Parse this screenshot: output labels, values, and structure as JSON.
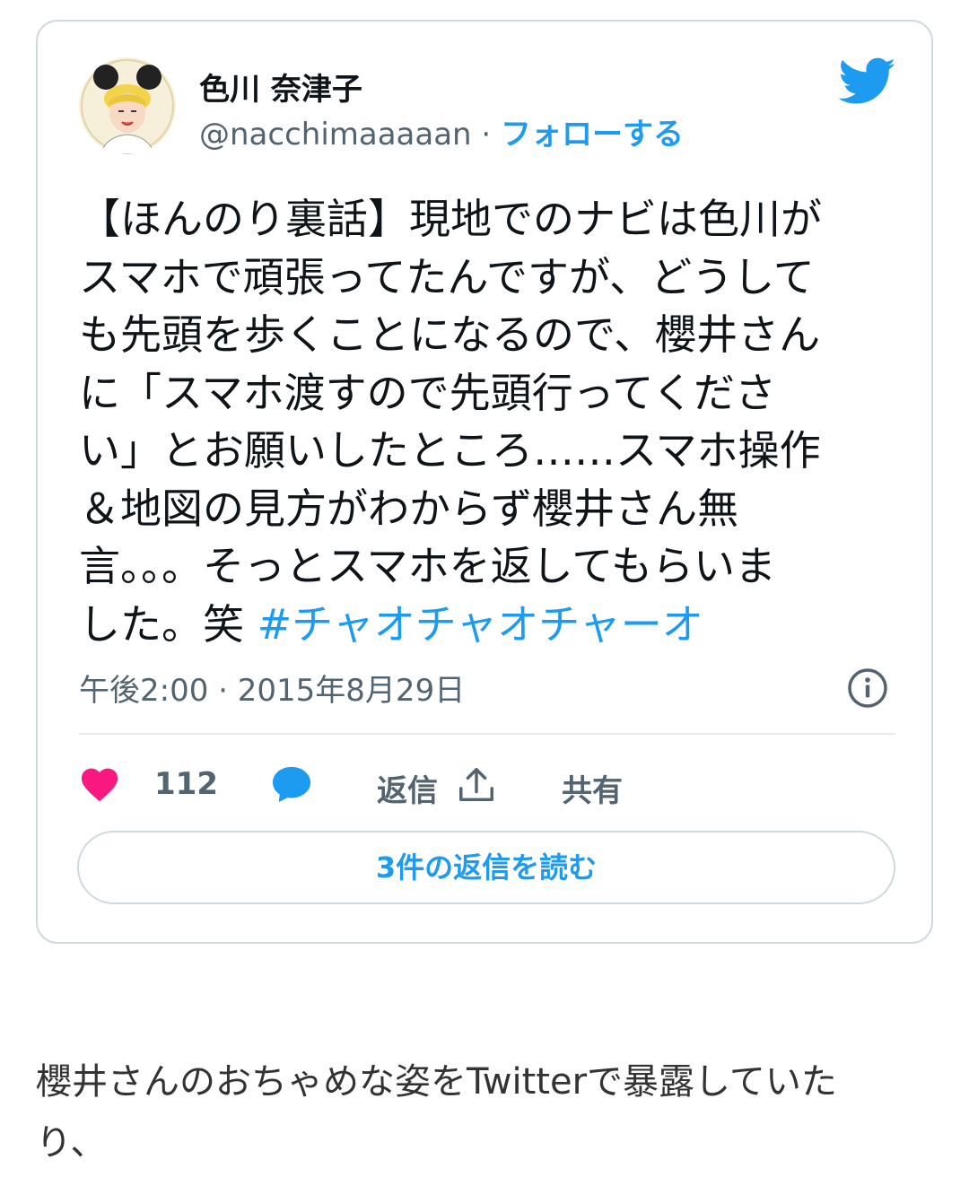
{
  "tweet": {
    "display_name": "色川 奈津子",
    "handle": "@nacchimaaaaan",
    "separator": "·",
    "follow_label": "フォローする",
    "text_lines": [
      "【ほんのり裏話】現地でのナビは色川が",
      "スマホで頑張ってたんですが、どうして",
      "も先頭を歩くことになるので、櫻井さん",
      "に「スマホ渡すので先頭行ってくださ",
      "い」とお願いしたところ……スマホ操作",
      "＆地図の見方がわからず櫻井さん無",
      "言。。。そっとスマホを返してもらいま"
    ],
    "last_line_text": "した。笑 ",
    "hashtag": "#チャオチャオチャーオ",
    "timestamp": "午後2:00 · 2015年8月29日",
    "likes_count": "112",
    "reply_label": "返信",
    "share_label": "共有",
    "read_replies_label": "3件の返信を読む"
  },
  "icons": {
    "logo": "twitter-bird-icon",
    "info": "info-icon",
    "like": "heart-icon",
    "reply": "speech-bubble-icon",
    "share": "share-upload-icon"
  },
  "colors": {
    "accent": "#1d9bf0",
    "heart": "#f91880",
    "text": "#0f1419",
    "muted": "#536471",
    "border": "#cfd9de"
  },
  "article": {
    "text_line1": "櫻井さんのおちゃめな姿をTwitterで暴露していた",
    "text_line2": "り、"
  }
}
